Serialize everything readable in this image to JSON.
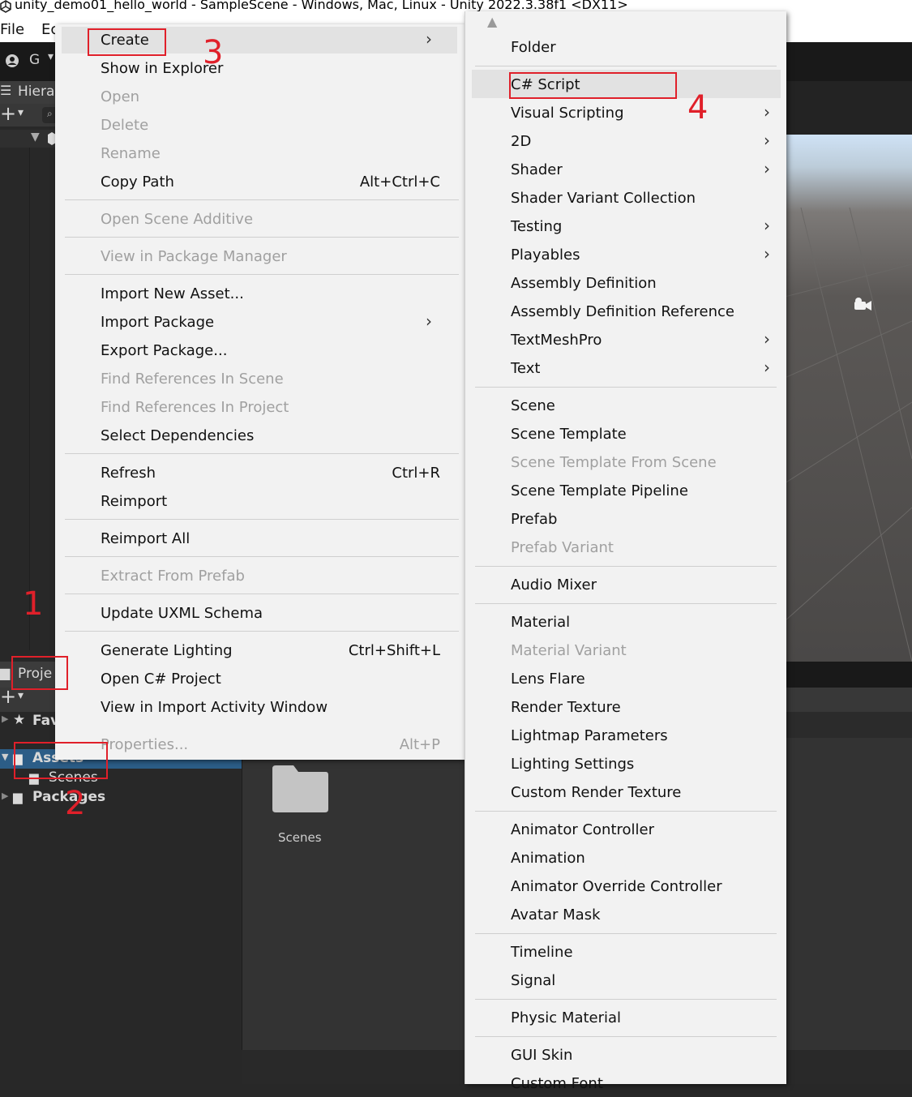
{
  "window": {
    "title": "unity_demo01_hello_world - SampleScene - Windows, Mac, Linux - Unity 2022.3.38f1 <DX11>"
  },
  "menubar": {
    "file": "File",
    "edit": "Ec"
  },
  "toolbar": {
    "account_label": "G"
  },
  "hierarchy": {
    "tab_label": "Hiera"
  },
  "project": {
    "tab_label": "Proje",
    "favorites_label": "Fav",
    "assets_label": "Assets",
    "scenes_label": "Scenes",
    "packages_label": "Packages",
    "folder_label": "Scenes"
  },
  "context_menu": {
    "items": [
      {
        "label": "Create",
        "shortcut": "",
        "submenu": true,
        "disabled": false
      },
      {
        "label": "Show in Explorer",
        "shortcut": "",
        "submenu": false,
        "disabled": false
      },
      {
        "label": "Open",
        "shortcut": "",
        "submenu": false,
        "disabled": true
      },
      {
        "label": "Delete",
        "shortcut": "",
        "submenu": false,
        "disabled": true
      },
      {
        "label": "Rename",
        "shortcut": "",
        "submenu": false,
        "disabled": true
      },
      {
        "label": "Copy Path",
        "shortcut": "Alt+Ctrl+C",
        "submenu": false,
        "disabled": false
      },
      {
        "label": "Open Scene Additive",
        "shortcut": "",
        "submenu": false,
        "disabled": true
      },
      {
        "label": "View in Package Manager",
        "shortcut": "",
        "submenu": false,
        "disabled": true
      },
      {
        "label": "Import New Asset...",
        "shortcut": "",
        "submenu": false,
        "disabled": false
      },
      {
        "label": "Import Package",
        "shortcut": "",
        "submenu": true,
        "disabled": false
      },
      {
        "label": "Export Package...",
        "shortcut": "",
        "submenu": false,
        "disabled": false
      },
      {
        "label": "Find References In Scene",
        "shortcut": "",
        "submenu": false,
        "disabled": true
      },
      {
        "label": "Find References In Project",
        "shortcut": "",
        "submenu": false,
        "disabled": true
      },
      {
        "label": "Select Dependencies",
        "shortcut": "",
        "submenu": false,
        "disabled": false
      },
      {
        "label": "Refresh",
        "shortcut": "Ctrl+R",
        "submenu": false,
        "disabled": false
      },
      {
        "label": "Reimport",
        "shortcut": "",
        "submenu": false,
        "disabled": false
      },
      {
        "label": "Reimport All",
        "shortcut": "",
        "submenu": false,
        "disabled": false
      },
      {
        "label": "Extract From Prefab",
        "shortcut": "",
        "submenu": false,
        "disabled": true
      },
      {
        "label": "Update UXML Schema",
        "shortcut": "",
        "submenu": false,
        "disabled": false
      },
      {
        "label": "Generate Lighting",
        "shortcut": "Ctrl+Shift+L",
        "submenu": false,
        "disabled": false
      },
      {
        "label": "Open C# Project",
        "shortcut": "",
        "submenu": false,
        "disabled": false
      },
      {
        "label": "View in Import Activity Window",
        "shortcut": "",
        "submenu": false,
        "disabled": false
      },
      {
        "label": "Properties...",
        "shortcut": "Alt+P",
        "submenu": false,
        "disabled": true
      }
    ]
  },
  "create_submenu": {
    "items": [
      {
        "label": "Folder",
        "submenu": false,
        "disabled": false
      },
      {
        "label": "C# Script",
        "submenu": false,
        "disabled": false
      },
      {
        "label": "Visual Scripting",
        "submenu": true,
        "disabled": false
      },
      {
        "label": "2D",
        "submenu": true,
        "disabled": false
      },
      {
        "label": "Shader",
        "submenu": true,
        "disabled": false
      },
      {
        "label": "Shader Variant Collection",
        "submenu": false,
        "disabled": false
      },
      {
        "label": "Testing",
        "submenu": true,
        "disabled": false
      },
      {
        "label": "Playables",
        "submenu": true,
        "disabled": false
      },
      {
        "label": "Assembly Definition",
        "submenu": false,
        "disabled": false
      },
      {
        "label": "Assembly Definition Reference",
        "submenu": false,
        "disabled": false
      },
      {
        "label": "TextMeshPro",
        "submenu": true,
        "disabled": false
      },
      {
        "label": "Text",
        "submenu": true,
        "disabled": false
      },
      {
        "label": "Scene",
        "submenu": false,
        "disabled": false
      },
      {
        "label": "Scene Template",
        "submenu": false,
        "disabled": false
      },
      {
        "label": "Scene Template From Scene",
        "submenu": false,
        "disabled": true
      },
      {
        "label": "Scene Template Pipeline",
        "submenu": false,
        "disabled": false
      },
      {
        "label": "Prefab",
        "submenu": false,
        "disabled": false
      },
      {
        "label": "Prefab Variant",
        "submenu": false,
        "disabled": true
      },
      {
        "label": "Audio Mixer",
        "submenu": false,
        "disabled": false
      },
      {
        "label": "Material",
        "submenu": false,
        "disabled": false
      },
      {
        "label": "Material Variant",
        "submenu": false,
        "disabled": true
      },
      {
        "label": "Lens Flare",
        "submenu": false,
        "disabled": false
      },
      {
        "label": "Render Texture",
        "submenu": false,
        "disabled": false
      },
      {
        "label": "Lightmap Parameters",
        "submenu": false,
        "disabled": false
      },
      {
        "label": "Lighting Settings",
        "submenu": false,
        "disabled": false
      },
      {
        "label": "Custom Render Texture",
        "submenu": false,
        "disabled": false
      },
      {
        "label": "Animator Controller",
        "submenu": false,
        "disabled": false
      },
      {
        "label": "Animation",
        "submenu": false,
        "disabled": false
      },
      {
        "label": "Animator Override Controller",
        "submenu": false,
        "disabled": false
      },
      {
        "label": "Avatar Mask",
        "submenu": false,
        "disabled": false
      },
      {
        "label": "Timeline",
        "submenu": false,
        "disabled": false
      },
      {
        "label": "Signal",
        "submenu": false,
        "disabled": false
      },
      {
        "label": "Physic Material",
        "submenu": false,
        "disabled": false
      },
      {
        "label": "GUI Skin",
        "submenu": false,
        "disabled": false
      },
      {
        "label": "Custom Font",
        "submenu": false,
        "disabled": false
      }
    ]
  },
  "annotations": [
    "1",
    "2",
    "3",
    "4"
  ],
  "colors": {
    "annotation": "#e0202a",
    "menu_bg": "#f2f2f2",
    "editor_bg": "#282828",
    "selection": "#2c5d87"
  }
}
